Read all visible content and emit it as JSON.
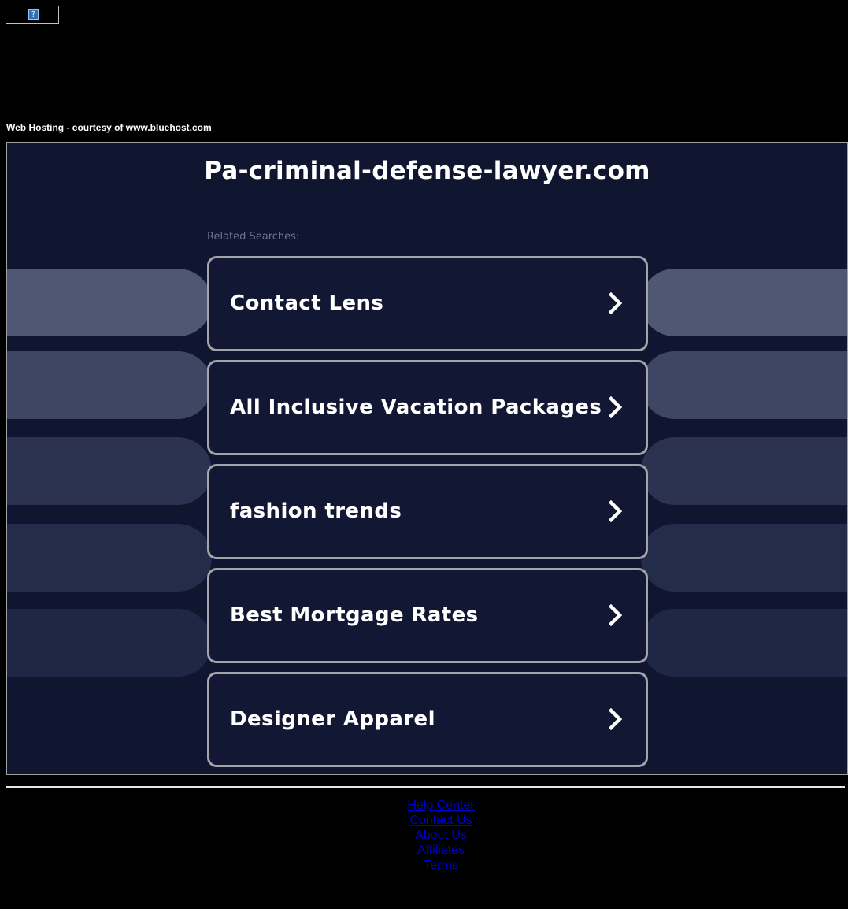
{
  "header": {
    "broken_image_glyph": "?",
    "hosting_text": "Web Hosting - courtesy of www.bluehost.com"
  },
  "main": {
    "site_title": "Pa-criminal-defense-lawyer.com",
    "related_label": "Related Searches:",
    "results": [
      {
        "label": "Contact Lens"
      },
      {
        "label": "All Inclusive Vacation Packages"
      },
      {
        "label": "fashion trends"
      },
      {
        "label": "Best Mortgage Rates"
      },
      {
        "label": "Designer Apparel"
      }
    ]
  },
  "footer": {
    "links": [
      {
        "label": "Help Center"
      },
      {
        "label": "Contact Us"
      },
      {
        "label": "About Us"
      },
      {
        "label": "Affiliates"
      },
      {
        "label": "Terms"
      }
    ]
  },
  "colors": {
    "page_bg": "#000000",
    "panel_bg": "#101630",
    "result_border": "#a3a3a8",
    "side_pill_1": "#4f5872",
    "side_pill_2": "#3d4663",
    "side_pill_3": "#2b3350",
    "side_pill_4": "#232c4a",
    "side_pill_5": "#1e2745",
    "link": "#0000cc"
  },
  "icons": {
    "result_arrow": "chevron-right-icon",
    "broken_image": "broken-image-icon"
  }
}
